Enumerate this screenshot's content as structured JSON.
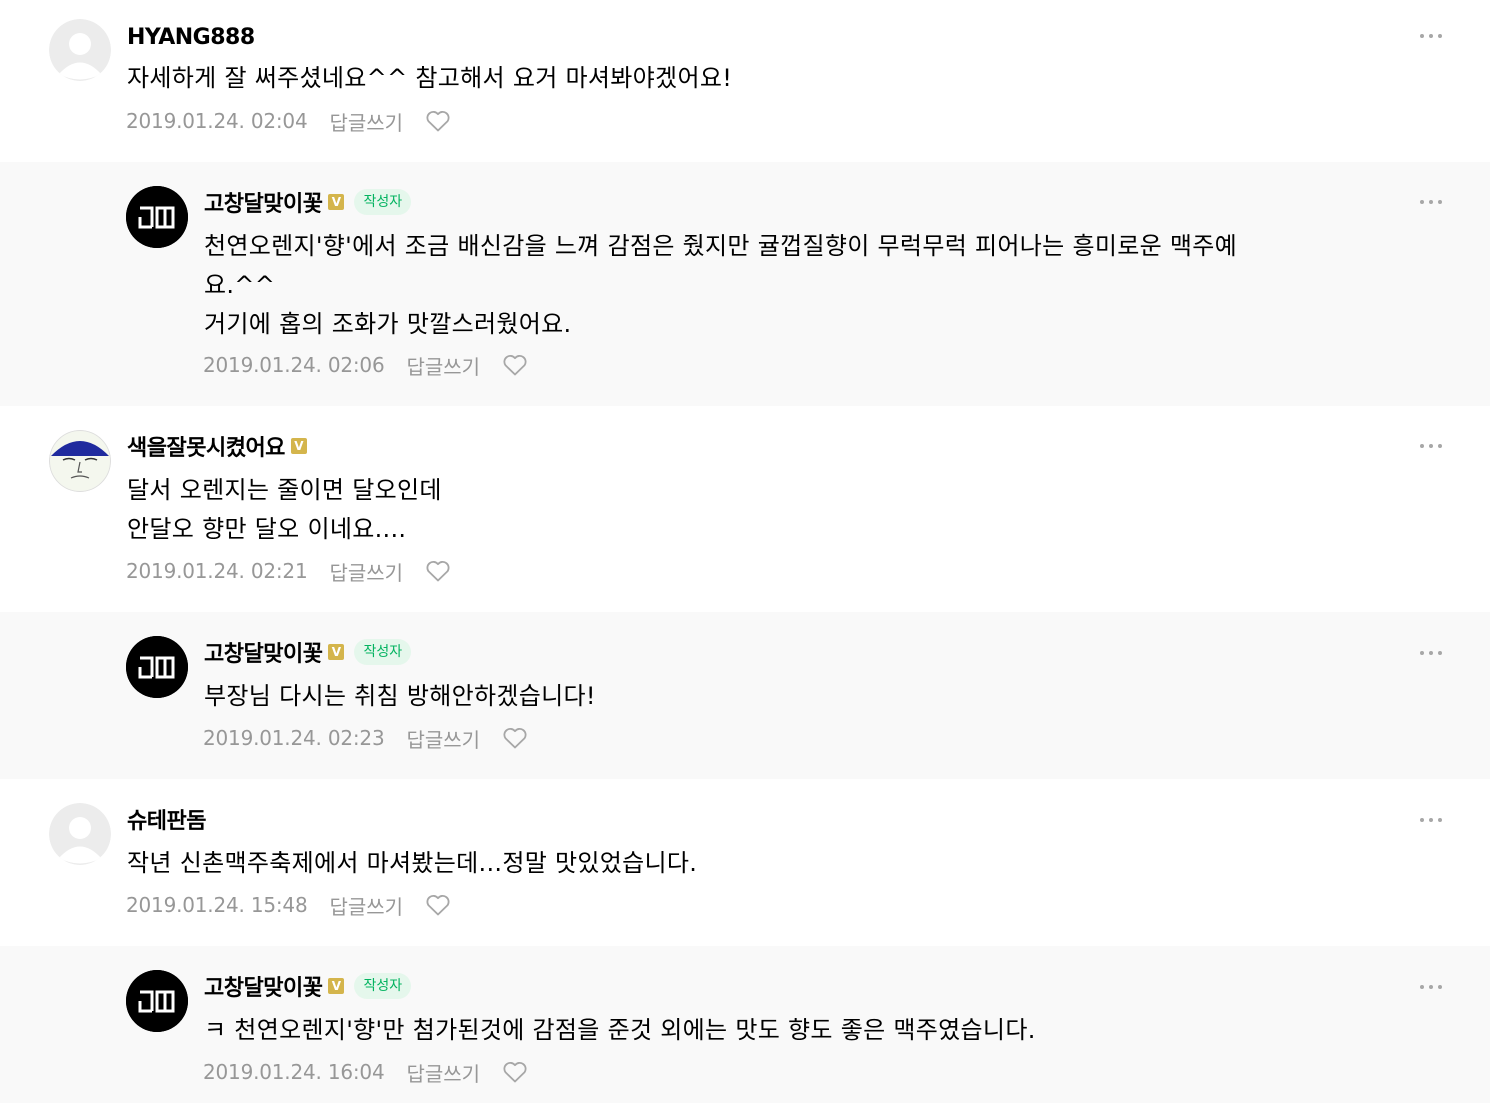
{
  "colors": {
    "reply_background": "#f9f9f9",
    "author_badge_bg": "#e5f7ec",
    "author_badge_text": "#03b360",
    "verified_badge": "#d4b54c",
    "meta_text": "#979797"
  },
  "comments": [
    {
      "author": "HYANG888",
      "verified": false,
      "is_post_author": false,
      "avatar": "default-profile-icon",
      "text": "자세하게 잘 써주셨네요^^ 참고해서 요거 마셔봐야겠어요!",
      "date": "2019.01.24. 02:04",
      "reply_label": "답글쓰기"
    },
    {
      "author": "고창달맞이꽃",
      "verified": true,
      "verified_mark": "V",
      "is_post_author": true,
      "author_badge": "작성자",
      "avatar": "blog-logo",
      "text": "천연오렌지'향'에서 조금 배신감을 느껴 감점은 줬지만 귤껍질향이 무럭무럭 피어나는 흥미로운 맥주예\n요.^^\n거기에 홉의 조화가 맛깔스러웠어요.",
      "date": "2019.01.24. 02:06",
      "reply_label": "답글쓰기"
    },
    {
      "author": "색을잘못시켰어요",
      "verified": true,
      "verified_mark": "V",
      "is_post_author": false,
      "avatar": "cartoon-face-avatar",
      "text": "달서 오렌지는 줄이면 달오인데\n안달오 향만 달오 이네요....",
      "date": "2019.01.24. 02:21",
      "reply_label": "답글쓰기"
    },
    {
      "author": "고창달맞이꽃",
      "verified": true,
      "verified_mark": "V",
      "is_post_author": true,
      "author_badge": "작성자",
      "avatar": "blog-logo",
      "text": "부장님 다시는 취침 방해안하겠습니다!",
      "date": "2019.01.24. 02:23",
      "reply_label": "답글쓰기"
    },
    {
      "author": "슈테판돔",
      "verified": false,
      "is_post_author": false,
      "avatar": "default-profile-icon",
      "text": "작년 신촌맥주축제에서 마셔봤는데...정말 맛있었습니다.",
      "date": "2019.01.24. 15:48",
      "reply_label": "답글쓰기"
    },
    {
      "author": "고창달맞이꽃",
      "verified": true,
      "verified_mark": "V",
      "is_post_author": true,
      "author_badge": "작성자",
      "avatar": "blog-logo",
      "text": "ㅋ 천연오렌지'향'만 첨가된것에 감점을 준것 외에는 맛도 향도 좋은 맥주였습니다.",
      "date": "2019.01.24. 16:04",
      "reply_label": "답글쓰기"
    }
  ]
}
